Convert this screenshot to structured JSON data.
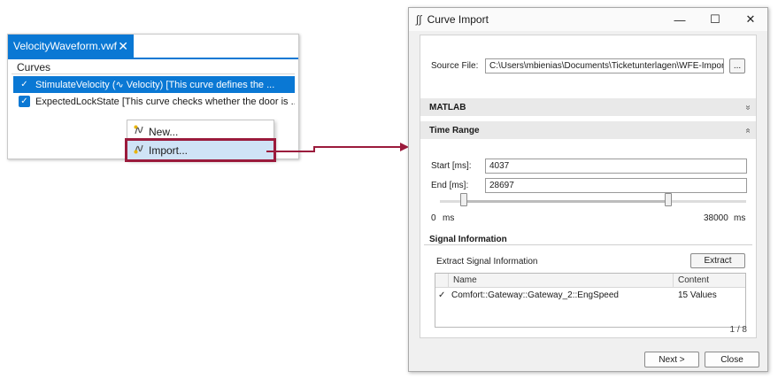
{
  "left_panel": {
    "tab_title": "VelocityWaveform.vwf",
    "tab_close": "✕",
    "curves_header": "Curves",
    "curves": [
      {
        "text": "StimulateVelocity (∿ Velocity) [This curve defines the ...",
        "checked": true,
        "selected": true
      },
      {
        "text": "ExpectedLockState [This curve checks whether the door is ...",
        "checked": true,
        "selected": false
      }
    ],
    "context_menu": [
      {
        "label": "New...",
        "icon": "waveform-new-icon"
      },
      {
        "label": "Import...",
        "icon": "waveform-import-icon"
      }
    ]
  },
  "dialog": {
    "title": "Curve Import",
    "title_icon": "∫∫",
    "minimize": "—",
    "maximize": "☐",
    "close": "✕",
    "source_file_label": "Source File:",
    "source_file_value": "C:\\Users\\mbienias\\Documents\\Ticketunterlagen\\WFE-Import\\Daten",
    "browse_label": "...",
    "matlab_header": "MATLAB",
    "matlab_chevron": "»",
    "time_range_header": "Time Range",
    "time_range_chevron": "«",
    "start_label": "Start [ms]:",
    "start_value": "4037",
    "end_label": "End [ms]:",
    "end_value": "28697",
    "slider_min_label": "0",
    "slider_min_unit": "ms",
    "slider_max_label": "38000",
    "slider_max_unit": "ms",
    "signal_info_header": "Signal Information",
    "extract_info_label": "Extract Signal Information",
    "extract_button": "Extract",
    "grid_columns": [
      "Name",
      "Content"
    ],
    "grid_rows": [
      {
        "checked": true,
        "name": "Comfort::Gateway::Gateway_2::EngSpeed",
        "content": "15 Values"
      }
    ],
    "pager": "1 / 8",
    "next_button": "Next >",
    "close_button": "Close"
  },
  "colors": {
    "accent": "#0a78d4",
    "highlight_outline": "#9b1b3c",
    "selection_light": "#cfe3f6"
  }
}
